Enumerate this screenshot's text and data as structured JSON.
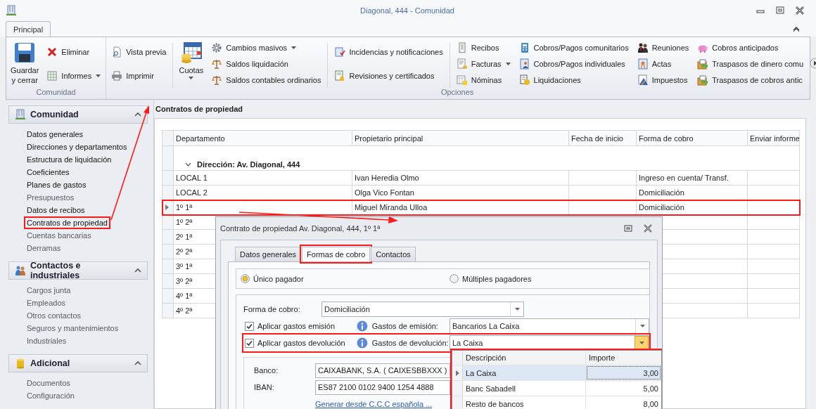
{
  "window": {
    "title": "Diagonal, 444 - Comunidad"
  },
  "ribbon": {
    "tabs": [
      {
        "label": "Principal",
        "selected": true
      }
    ],
    "groups": [
      {
        "label": "Comunidad",
        "sections": [
          {
            "columns": [
              {
                "kind": "large",
                "items": [
                  {
                    "label": "Guardar y cerrar",
                    "dropdown": false
                  }
                ]
              },
              {
                "kind": "stack",
                "items": [
                  {
                    "label": "Eliminar",
                    "dropdown": false
                  },
                  {
                    "label": "Informes",
                    "dropdown": true
                  }
                ]
              }
            ]
          }
        ]
      },
      {
        "label": "Opciones",
        "sections": [
          {
            "columns": [
              {
                "kind": "stack",
                "items": [
                  {
                    "label": "Vista previa",
                    "dropdown": false
                  },
                  {
                    "label": "Imprimir",
                    "dropdown": false
                  }
                ]
              }
            ]
          },
          {
            "columns": [
              {
                "kind": "large",
                "items": [
                  {
                    "label": "Cuotas",
                    "dropdown": true
                  }
                ]
              },
              {
                "kind": "stack",
                "items": [
                  {
                    "label": "Cambios masivos",
                    "dropdown": true
                  },
                  {
                    "label": "Saldos liquidación",
                    "dropdown": false
                  },
                  {
                    "label": "Saldos contables ordinarios",
                    "dropdown": false
                  }
                ]
              }
            ]
          },
          {
            "columns": [
              {
                "kind": "stack",
                "items": [
                  {
                    "label": "Incidencias y notificaciones",
                    "dropdown": false
                  },
                  {
                    "label": "Revisiones y certificados",
                    "dropdown": false
                  }
                ]
              }
            ]
          },
          {
            "columns": [
              {
                "kind": "stack",
                "items": [
                  {
                    "label": "Recibos",
                    "dropdown": false
                  },
                  {
                    "label": "Facturas",
                    "dropdown": true
                  },
                  {
                    "label": "Nóminas",
                    "dropdown": false
                  }
                ]
              },
              {
                "kind": "stack",
                "items": [
                  {
                    "label": "Cobros/Pagos comunitarios",
                    "dropdown": false
                  },
                  {
                    "label": "Cobros/Pagos individuales",
                    "dropdown": false
                  },
                  {
                    "label": "Liquidaciones",
                    "dropdown": false
                  }
                ]
              },
              {
                "kind": "stack",
                "items": [
                  {
                    "label": "Reuniones",
                    "dropdown": false
                  },
                  {
                    "label": "Actas",
                    "dropdown": false
                  },
                  {
                    "label": "Impuestos",
                    "dropdown": false
                  }
                ]
              },
              {
                "kind": "stack",
                "items": [
                  {
                    "label": "Cobros anticipados",
                    "dropdown": false
                  },
                  {
                    "label": "Traspasos de dinero comu",
                    "dropdown": false
                  },
                  {
                    "label": "Traspasos de cobros antic",
                    "dropdown": false
                  }
                ]
              }
            ]
          }
        ]
      }
    ]
  },
  "sidebar": {
    "sections": [
      {
        "title": "Comunidad",
        "expanded": true,
        "items": [
          {
            "label": "Datos generales",
            "enabled": true,
            "highlighted": false
          },
          {
            "label": "Direcciones y departamentos",
            "enabled": true,
            "highlighted": false
          },
          {
            "label": "Estructura de liquidación",
            "enabled": true,
            "highlighted": false
          },
          {
            "label": "Coeficientes",
            "enabled": true,
            "highlighted": false
          },
          {
            "label": "Planes de gastos",
            "enabled": true,
            "highlighted": false
          },
          {
            "label": "Presupuestos",
            "enabled": false,
            "highlighted": false
          },
          {
            "label": "Datos de recibos",
            "enabled": true,
            "highlighted": false
          },
          {
            "label": "Contratos de propiedad",
            "enabled": true,
            "highlighted": true
          },
          {
            "label": "Cuentas bancarias",
            "enabled": false,
            "highlighted": false
          },
          {
            "label": "Derramas",
            "enabled": false,
            "highlighted": false
          }
        ]
      },
      {
        "title": "Contactos e industriales",
        "expanded": true,
        "items": [
          {
            "label": "Cargos junta",
            "enabled": false,
            "highlighted": false
          },
          {
            "label": "Empleados",
            "enabled": false,
            "highlighted": false
          },
          {
            "label": "Otros contactos",
            "enabled": false,
            "highlighted": false
          },
          {
            "label": "Seguros y mantenimientos",
            "enabled": false,
            "highlighted": false
          },
          {
            "label": "Industriales",
            "enabled": false,
            "highlighted": false
          }
        ]
      },
      {
        "title": "Adicional",
        "expanded": true,
        "items": [
          {
            "label": "Documentos",
            "enabled": false,
            "highlighted": false
          },
          {
            "label": "Configuración",
            "enabled": false,
            "highlighted": false
          }
        ]
      }
    ]
  },
  "panel": {
    "title": "Contratos de propiedad",
    "table": {
      "columns": [
        "Departamento",
        "Propietario principal",
        "Fecha de inicio",
        "Forma de cobro",
        "Enviar informe"
      ],
      "group": {
        "label": "Dirección: Av. Diagonal, 444",
        "expanded": true
      },
      "rows": [
        {
          "cells": [
            "LOCAL 1",
            "Ivan Heredia Olmo",
            "",
            "Ingreso en cuenta/ Transf.",
            ""
          ],
          "selected": false,
          "highlighted": false
        },
        {
          "cells": [
            "LOCAL 2",
            "Olga Vico Fontan",
            "",
            "Domiciliación",
            ""
          ],
          "selected": false,
          "highlighted": false
        },
        {
          "cells": [
            "1º 1ª",
            "Miguel Miranda Ulloa",
            "",
            "Domiciliación",
            ""
          ],
          "selected": true,
          "highlighted": true
        },
        {
          "cells": [
            "1º 2ª"
          ],
          "selected": false,
          "highlighted": false
        },
        {
          "cells": [
            "2º 1ª"
          ],
          "selected": false,
          "highlighted": false
        },
        {
          "cells": [
            "2º 2ª"
          ],
          "selected": false,
          "highlighted": false
        },
        {
          "cells": [
            "3º 1ª"
          ],
          "selected": false,
          "highlighted": false
        },
        {
          "cells": [
            "3º 2ª"
          ],
          "selected": false,
          "highlighted": false
        },
        {
          "cells": [
            "4º 1ª"
          ],
          "selected": false,
          "highlighted": false
        },
        {
          "cells": [
            "4º 2ª"
          ],
          "selected": false,
          "highlighted": false
        }
      ]
    }
  },
  "dialog": {
    "title": "Contrato de propiedad Av. Diagonal, 444, 1º 1ª",
    "tabs": [
      {
        "label": "Datos generales",
        "selected": false,
        "highlighted": false
      },
      {
        "label": "Formas de cobro",
        "selected": true,
        "highlighted": true
      },
      {
        "label": "Contactos",
        "selected": false,
        "highlighted": false
      }
    ],
    "payers": [
      {
        "label": "Único pagador",
        "selected": true
      },
      {
        "label": "Múltiples pagadores",
        "selected": false
      }
    ],
    "payment_method": {
      "label": "Forma de cobro:",
      "value": "Domiciliación"
    },
    "fees": [
      {
        "label": "Aplicar gastos emisión",
        "checked": true,
        "field_label": "Gastos de emisión:",
        "value": "Bancarios La Caixa",
        "open": false,
        "highlighted": false
      },
      {
        "label": "Aplicar gastos devolución",
        "checked": true,
        "field_label": "Gastos de devolución:",
        "value": "La Caixa",
        "open": true,
        "highlighted": true
      }
    ],
    "bank": {
      "label": "Banco:",
      "value": "CAIXABANK, S.A. ( CAIXESBBXXX )"
    },
    "iban": {
      "label": "IBAN:",
      "value": "ES87 2100 0102 9400 1254 4888"
    },
    "link": "Generar desde C.C.C española ...",
    "dropdown": {
      "highlighted": true,
      "columns": [
        "Descripción",
        "Importe"
      ],
      "rows": [
        {
          "description": "La Caixa",
          "amount": "3,00",
          "selected": true
        },
        {
          "description": "Banc Sabadell",
          "amount": "5,00",
          "selected": false
        },
        {
          "description": "Resto de bancos",
          "amount": "8,00",
          "selected": false
        }
      ]
    }
  }
}
